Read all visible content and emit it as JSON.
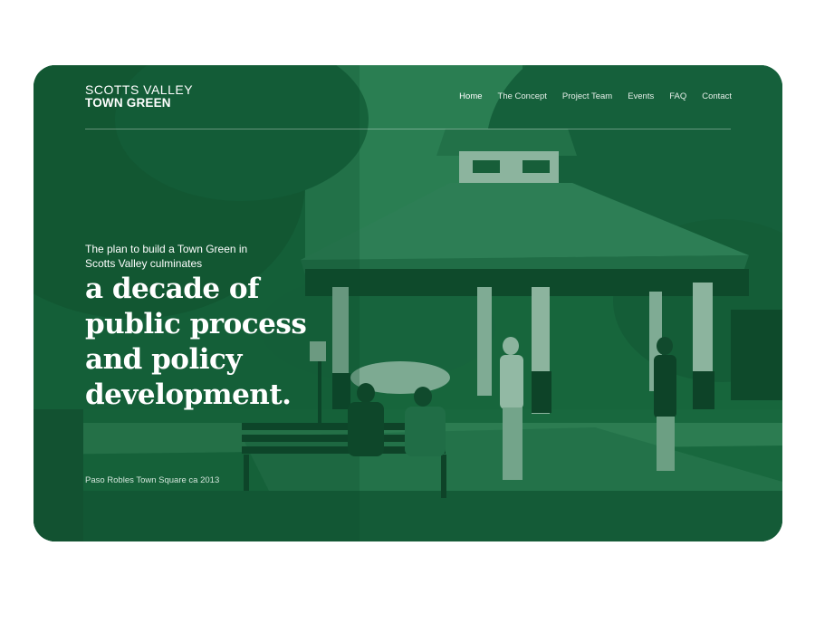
{
  "brand": {
    "line1": "SCOTTS VALLEY",
    "line2": "TOWN GREEN"
  },
  "nav": {
    "items": [
      {
        "label": "Home"
      },
      {
        "label": "The Concept"
      },
      {
        "label": "Project Team"
      },
      {
        "label": "Events"
      },
      {
        "label": "FAQ"
      },
      {
        "label": "Contact"
      }
    ],
    "active": "Home"
  },
  "hero": {
    "intro": "The plan to build a Town Green in Scotts Valley culminates",
    "headline": "a decade of public process and policy development.",
    "caption": "Paso Robles Town Square ca 2013"
  },
  "colors": {
    "overlay": "#1f6b44",
    "text": "#ffffff"
  }
}
